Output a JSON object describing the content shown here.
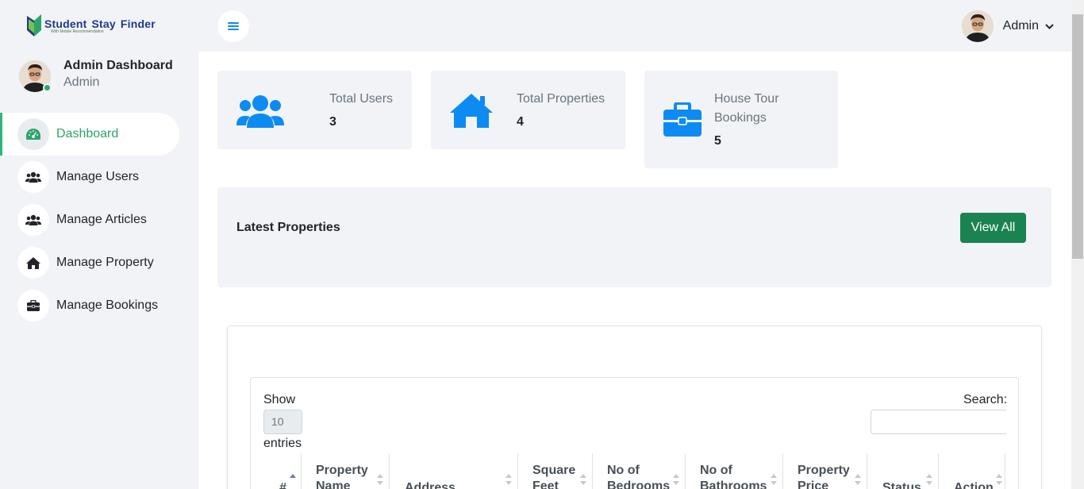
{
  "brand": {
    "title_part1": "Student",
    "title_part2": "Stay",
    "title_part3": "Finder",
    "tagline": "With Mobile Recommendation"
  },
  "profile": {
    "name": "Admin Dashboard",
    "role": "Admin"
  },
  "sidebar": {
    "items": [
      {
        "label": "Dashboard",
        "icon": "gauge-icon",
        "active": true
      },
      {
        "label": "Manage Users",
        "icon": "users-icon",
        "active": false
      },
      {
        "label": "Manage Articles",
        "icon": "users-icon",
        "active": false
      },
      {
        "label": "Manage Property",
        "icon": "home-icon",
        "active": false
      },
      {
        "label": "Manage Bookings",
        "icon": "briefcase-icon",
        "active": false
      }
    ]
  },
  "topbar": {
    "user_label": "Admin"
  },
  "stats": [
    {
      "label": "Total Users",
      "value": "3",
      "icon": "users-icon"
    },
    {
      "label": "Total Properties",
      "value": "4",
      "icon": "home-icon"
    },
    {
      "label_line1": "House Tour",
      "label_line2": "Bookings",
      "value": "5",
      "icon": "briefcase-icon"
    }
  ],
  "latest": {
    "title": "Latest Properties",
    "view_all": "View All"
  },
  "table": {
    "show_label": "Show",
    "length_value": "10",
    "entries_label": "entries",
    "search_label": "Search:",
    "columns": [
      {
        "line1": "#",
        "line2": ""
      },
      {
        "line1": "Property",
        "line2": "Name"
      },
      {
        "line1": "Address",
        "line2": ""
      },
      {
        "line1": "Square",
        "line2": "Feet"
      },
      {
        "line1": "No of",
        "line2": "Bedrooms"
      },
      {
        "line1": "No of",
        "line2": "Bathrooms"
      },
      {
        "line1": "Property",
        "line2": "Price"
      },
      {
        "line1": "Status",
        "line2": ""
      },
      {
        "line1": "Action",
        "line2": ""
      }
    ]
  },
  "colors": {
    "accent_green": "#2ca56a",
    "button_green": "#1a8350",
    "icon_blue": "#0d8bf2",
    "panel_bg": "#f1f3f6"
  }
}
